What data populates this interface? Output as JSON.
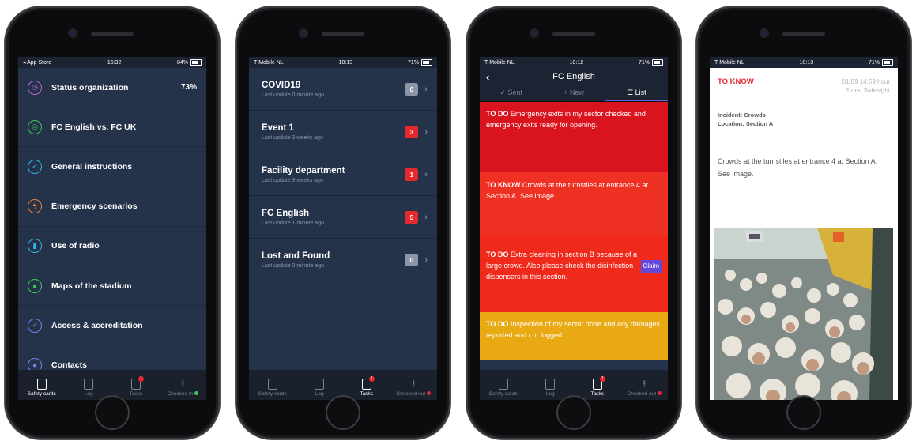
{
  "screen1": {
    "status": {
      "left": "◂ App Store",
      "time": "15:32",
      "battery": "84%"
    },
    "menu": [
      {
        "label": "Status organization",
        "value": "73%",
        "icon": "gauge-icon",
        "color": "#c264d6"
      },
      {
        "label": "FC English vs. FC UK",
        "value": "",
        "icon": "watch-icon",
        "color": "#3ec75a"
      },
      {
        "label": "General instructions",
        "value": "",
        "icon": "clipboard-icon",
        "color": "#2fb6e8"
      },
      {
        "label": "Emergency scenarios",
        "value": "",
        "icon": "lightning-icon",
        "color": "#f07a2e"
      },
      {
        "label": "Use of radio",
        "value": "",
        "icon": "radio-icon",
        "color": "#2fb6e8"
      },
      {
        "label": "Maps of the stadium",
        "value": "",
        "icon": "map-pin-icon",
        "color": "#3ec75a"
      },
      {
        "label": "Access & accreditation",
        "value": "",
        "icon": "shield-icon",
        "color": "#7a82f0"
      },
      {
        "label": "Contacts",
        "value": "",
        "icon": "person-icon",
        "color": "#7a82f0"
      }
    ],
    "tabs": {
      "safety": "Safety cards",
      "log": "Log",
      "tasks": "Tasks",
      "checked": "Checked in",
      "badge": "1"
    }
  },
  "screen2": {
    "status": {
      "left": "T-Mobile NL",
      "time": "10:13",
      "battery": "71%"
    },
    "items": [
      {
        "title": "COVID19",
        "sub": "Last update 0 minute ago",
        "count": "0",
        "color": "#8b95a6"
      },
      {
        "title": "Event 1",
        "sub": "Last update 3 weeks ago",
        "count": "3",
        "color": "#e5282e"
      },
      {
        "title": "Facility department",
        "sub": "Last update 3 weeks ago",
        "count": "1",
        "color": "#e5282e"
      },
      {
        "title": "FC English",
        "sub": "Last update 1 minute ago",
        "count": "5",
        "color": "#e5282e"
      },
      {
        "title": "Lost and Found",
        "sub": "Last update 0 minute ago",
        "count": "0",
        "color": "#8b95a6"
      }
    ],
    "tabs": {
      "safety": "Safety cards",
      "log": "Log",
      "tasks": "Tasks",
      "checked": "Checked out",
      "badge": "1"
    }
  },
  "screen3": {
    "status": {
      "left": "T-Mobile NL",
      "time": "10:12",
      "battery": "71%"
    },
    "title": "FC English",
    "segments": [
      "✓ Sent",
      "+ New",
      "☰ List"
    ],
    "cards": [
      {
        "tag": "TO DO",
        "text": "Emergency exits in my sector checked and emergency exits ready for opening.",
        "color": "#d9141e"
      },
      {
        "tag": "TO KNOW",
        "text": "Crowds at the turnstiles at entrance 4 at Section A. See image.",
        "color": "#ef3124"
      },
      {
        "tag": "TO DO",
        "text": "Extra cleaning in section B because of a large crowd. Also please check the disinfection dispensers in this section.",
        "color": "#f02a1a",
        "claim": "Claim"
      },
      {
        "tag": "TO DO",
        "text": "Inspection of my sector done and any damages reported and / or logged.",
        "color": "#e9a913"
      }
    ],
    "tabs": {
      "safety": "Safety cards",
      "log": "Log",
      "tasks": "Tasks",
      "checked": "Checked out",
      "badge": "1"
    }
  },
  "screen4": {
    "status": {
      "left": "T-Mobile NL",
      "time": "10:13",
      "battery": "71%"
    },
    "kind": "TO KNOW",
    "date": "01/09 14:59 hour",
    "from": "From: Safesight",
    "incident": "Incident: Crowds",
    "location": "Location: Section A",
    "message": "Crowds at the turnstiles at entrance 4 at Section A. See image."
  }
}
